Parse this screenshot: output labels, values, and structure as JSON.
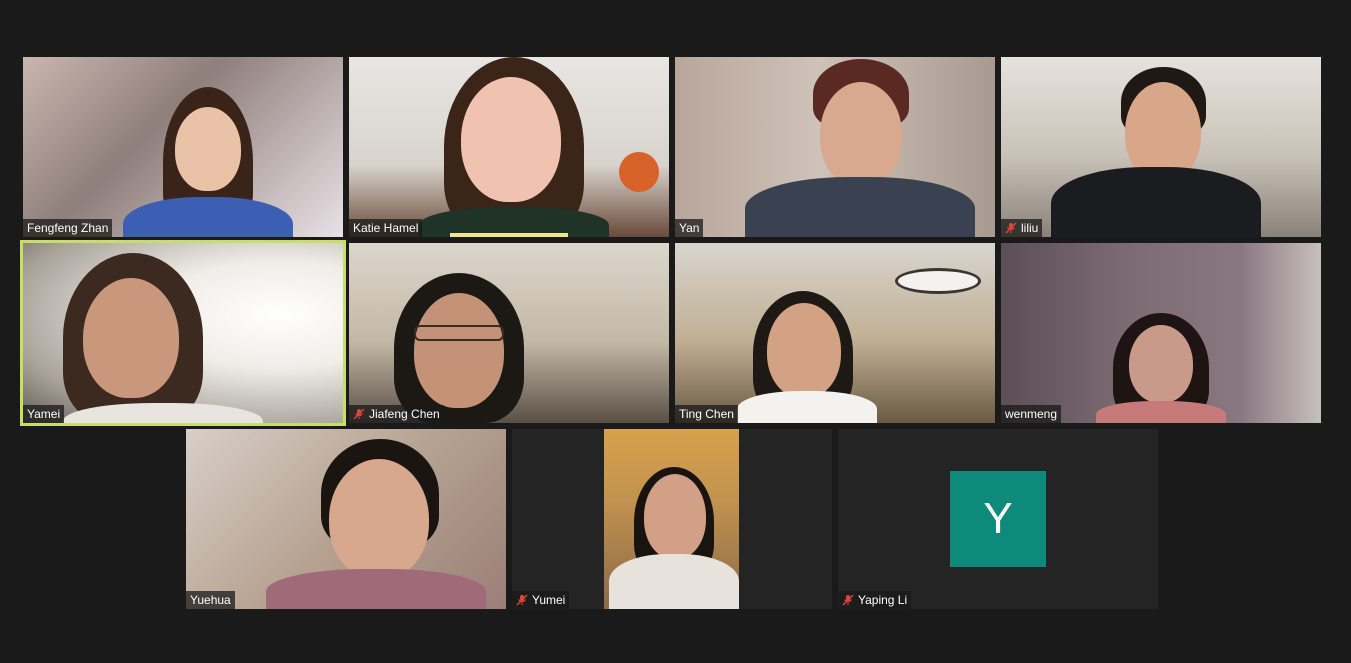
{
  "participants": [
    {
      "name": "Fengfeng Zhan",
      "muted": false
    },
    {
      "name": "Katie Hamel",
      "muted": false,
      "speaking": true
    },
    {
      "name": "Yan",
      "muted": false
    },
    {
      "name": "liliu",
      "muted": true
    },
    {
      "name": "Yamei",
      "muted": false,
      "active": true
    },
    {
      "name": "Jiafeng Chen",
      "muted": true
    },
    {
      "name": "Ting Chen",
      "muted": false
    },
    {
      "name": "wenmeng",
      "muted": false
    },
    {
      "name": "Yuehua",
      "muted": false
    },
    {
      "name": "Yumei",
      "muted": true
    },
    {
      "name": "Yaping Li",
      "muted": true,
      "avatar_letter": "Y"
    }
  ],
  "colors": {
    "background": "#1a1a1a",
    "active_speaker_outline": "#c8e05a",
    "avatar": "#0e8a7a",
    "muted_icon": "#e0453a"
  },
  "icons": {
    "muted": "mic-muted-icon"
  }
}
